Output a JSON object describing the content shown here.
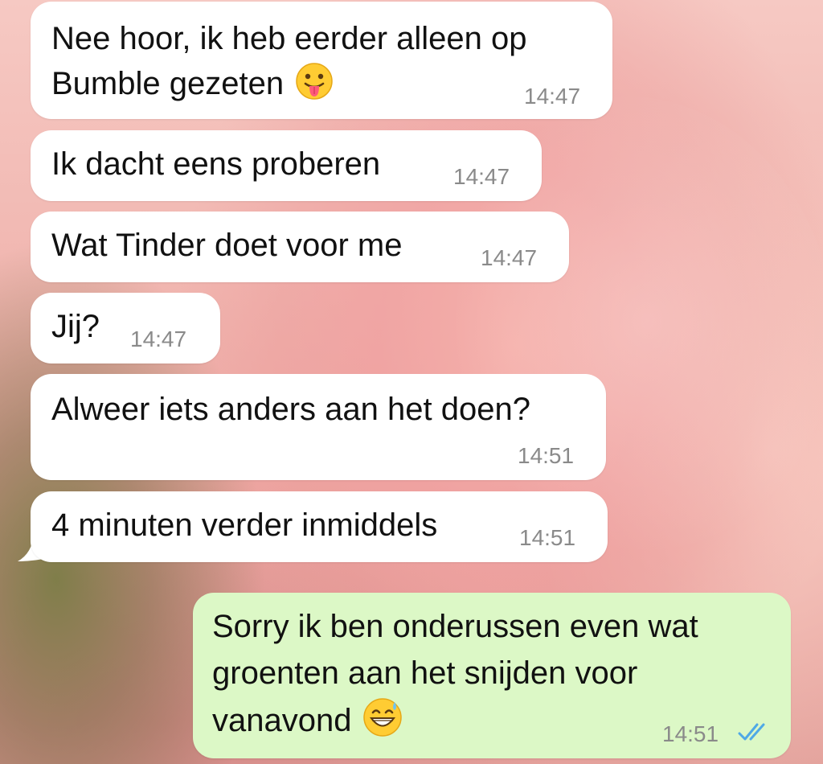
{
  "chat": {
    "messages": [
      {
        "direction": "incoming",
        "lines": [
          "Nee hoor, ik heb eerder alleen op",
          "Bumble gezeten"
        ],
        "emoji": "face-with-tongue-icon",
        "time": "14:47"
      },
      {
        "direction": "incoming",
        "lines": [
          "Ik dacht eens proberen"
        ],
        "time": "14:47"
      },
      {
        "direction": "incoming",
        "lines": [
          "Wat Tinder doet voor me"
        ],
        "time": "14:47"
      },
      {
        "direction": "incoming",
        "lines": [
          "Jij?"
        ],
        "time": "14:47"
      },
      {
        "direction": "incoming",
        "lines": [
          "Alweer iets anders aan het doen?"
        ],
        "time": "14:51"
      },
      {
        "direction": "incoming",
        "lines": [
          "4 minuten verder inmiddels"
        ],
        "time": "14:51"
      },
      {
        "direction": "outgoing",
        "lines": [
          "Sorry ik ben onderussen even wat",
          "groenten aan het snijden voor",
          "vanavond"
        ],
        "emoji": "grinning-sweat-icon",
        "time": "14:51",
        "status": "read-double-check-icon"
      }
    ]
  },
  "colors": {
    "incoming_bubble": "#ffffff",
    "outgoing_bubble": "#dcf8c6",
    "text": "#111111",
    "timestamp": "#8a8a8a",
    "read_ticks": "#4fa9e6"
  }
}
